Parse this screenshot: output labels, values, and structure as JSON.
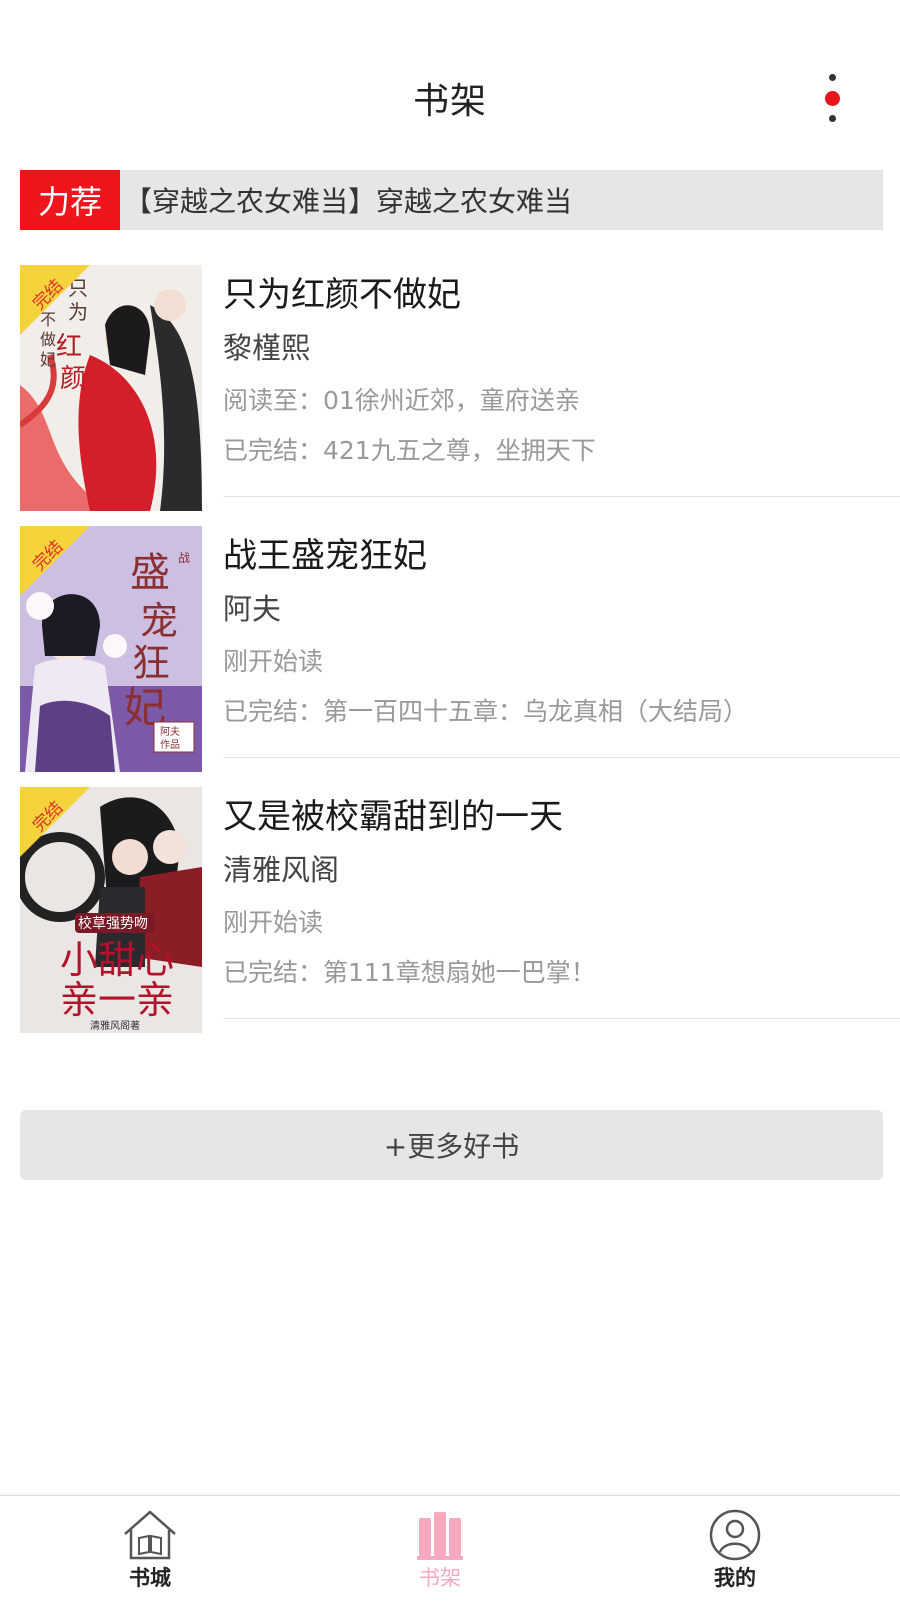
{
  "header": {
    "title": "书架",
    "menu_icon": "more-vertical-icon",
    "menu_accent": "#e8141c"
  },
  "recommend": {
    "tag": "力荐",
    "text": "【穿越之农女难当】穿越之农女难当",
    "tag_color": "#f0141c"
  },
  "books": [
    {
      "title": "只为红颜不做妃",
      "author": "黎槿熙",
      "progress": "阅读至：01徐州近郊，童府送亲",
      "latest": "已完结：421九五之尊，坐拥天下",
      "badge": "完结",
      "cover_text": "只为红颜不做妃"
    },
    {
      "title": "战王盛宠狂妃",
      "author": "阿夫",
      "progress": "刚开始读",
      "latest": "已完结：第一百四十五章：乌龙真相（大结局）",
      "badge": "完结",
      "cover_text": "战王盛宠狂妃",
      "cover_sub": "阿夫作品"
    },
    {
      "title": "又是被校霸甜到的一天",
      "author": "清雅风阁",
      "progress": "刚开始读",
      "latest": "已完结：第111章想扇她一巴掌！",
      "badge": "完结",
      "cover_text": "校草强势吻",
      "cover_big": "小甜心亲一亲",
      "cover_sub": "清雅风阁著"
    }
  ],
  "more_button": "+更多好书",
  "tabs": [
    {
      "label": "书城",
      "icon": "bookstore-house-icon",
      "active": false
    },
    {
      "label": "书架",
      "icon": "bookshelf-icon",
      "active": true
    },
    {
      "label": "我的",
      "icon": "user-profile-icon",
      "active": false
    }
  ],
  "colors": {
    "accent_red": "#f0141c",
    "active_tab": "#f7a9bf",
    "banner_bg": "#e6e6e6",
    "badge_yellow": "#f5d33b"
  }
}
